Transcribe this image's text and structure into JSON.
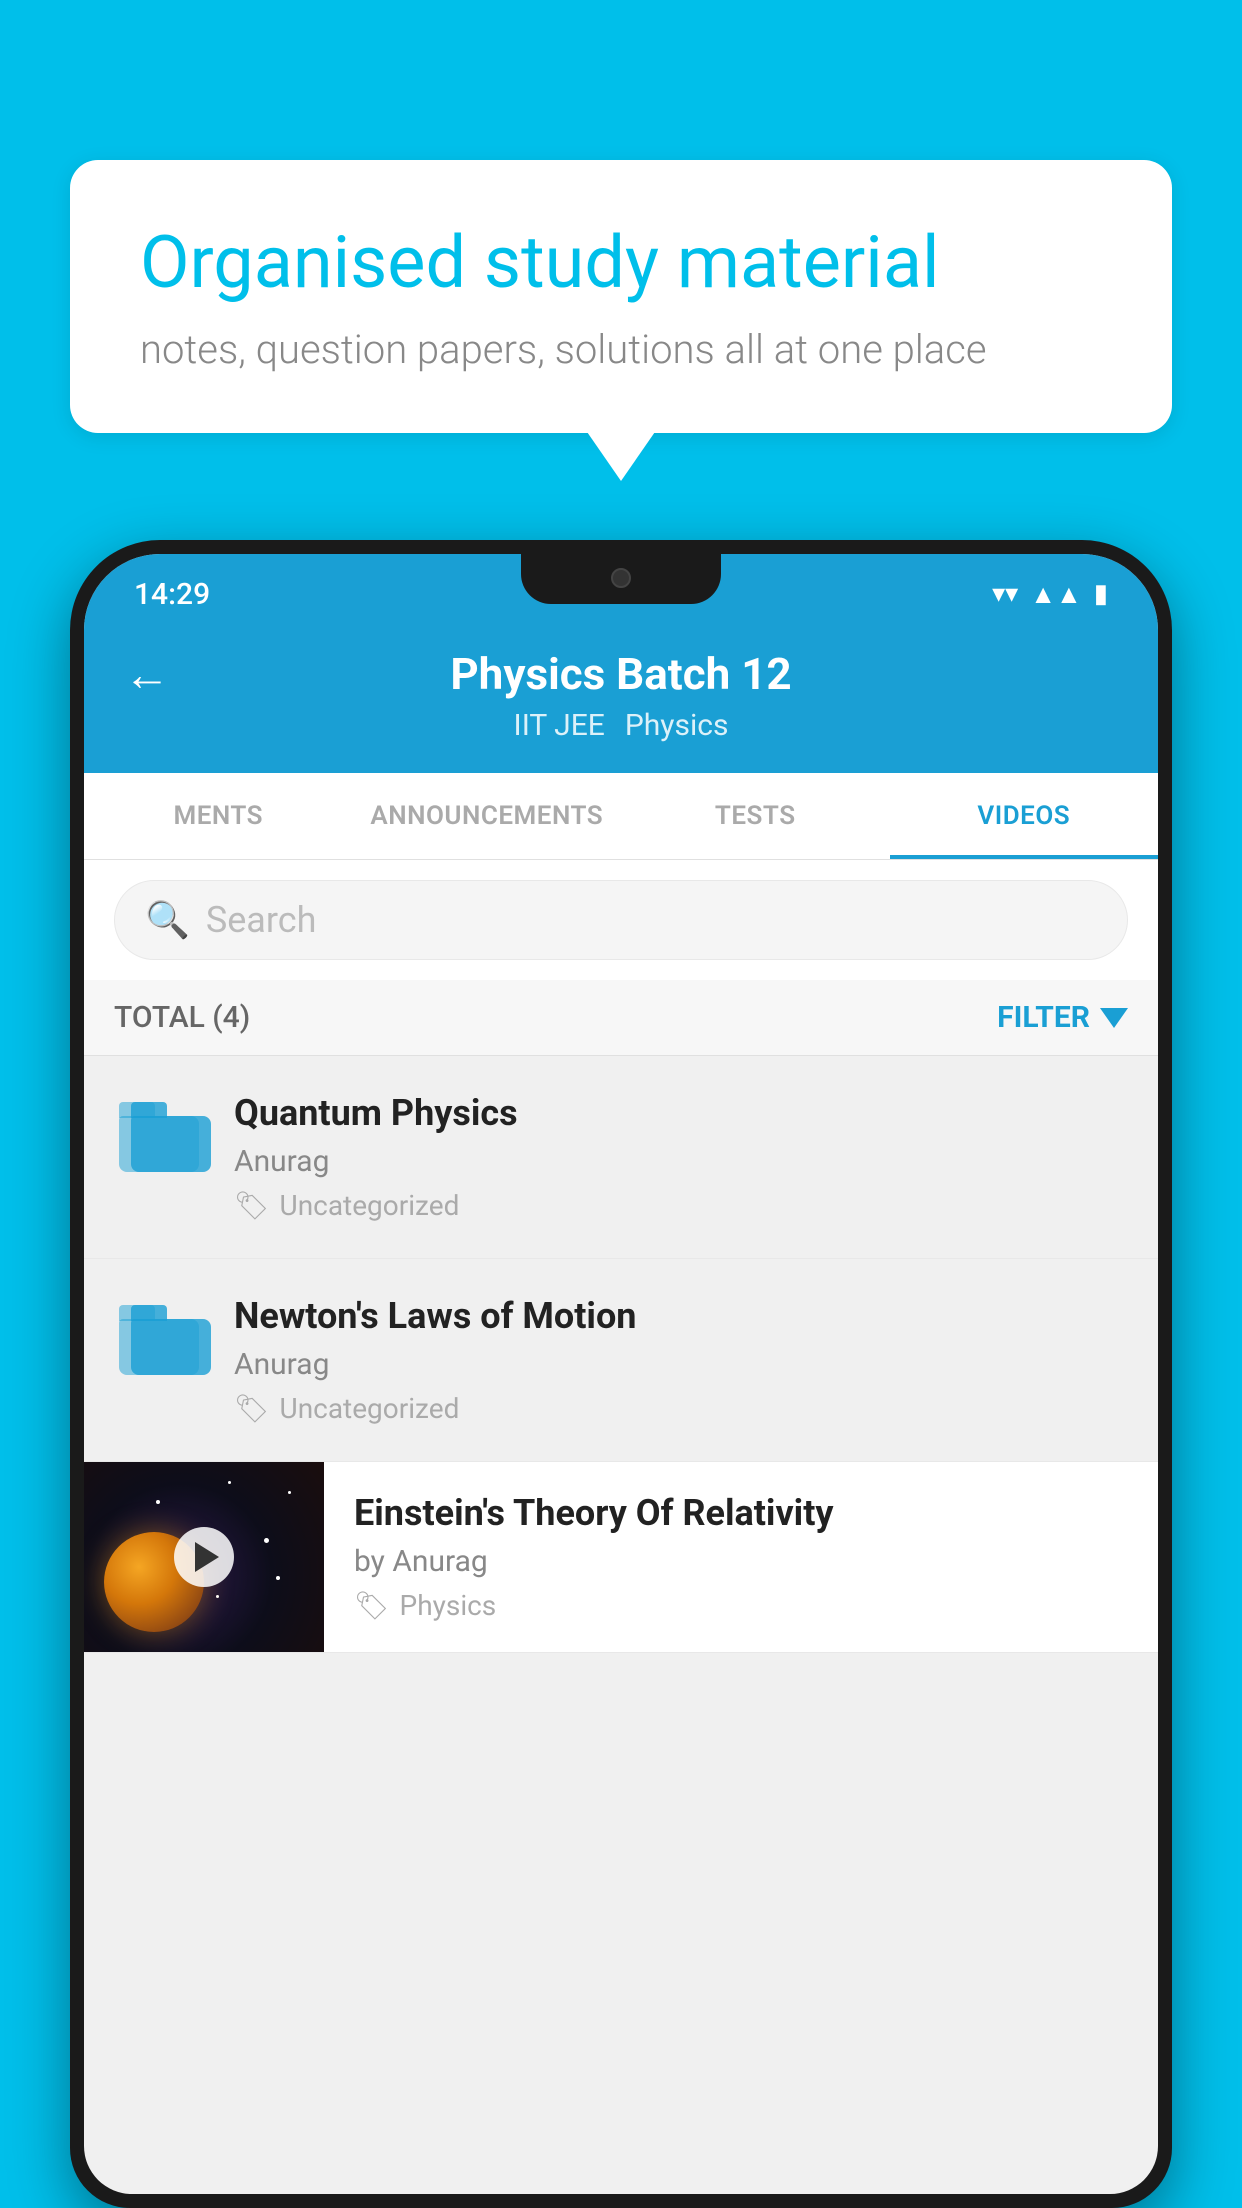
{
  "background": {
    "color": "#00BFEA"
  },
  "speech_bubble": {
    "title": "Organised study material",
    "subtitle": "notes, question papers, solutions all at one place"
  },
  "status_bar": {
    "time": "14:29"
  },
  "header": {
    "title": "Physics Batch 12",
    "subtitle_tag1": "IIT JEE",
    "subtitle_tag2": "Physics",
    "back_label": "←"
  },
  "tabs": [
    {
      "label": "MENTS",
      "active": false
    },
    {
      "label": "ANNOUNCEMENTS",
      "active": false
    },
    {
      "label": "TESTS",
      "active": false
    },
    {
      "label": "VIDEOS",
      "active": true
    }
  ],
  "search": {
    "placeholder": "Search"
  },
  "filter": {
    "total_label": "TOTAL (4)",
    "filter_label": "FILTER"
  },
  "list_items": [
    {
      "title": "Quantum Physics",
      "author": "Anurag",
      "tag": "Uncategorized",
      "type": "folder"
    },
    {
      "title": "Newton's Laws of Motion",
      "author": "Anurag",
      "tag": "Uncategorized",
      "type": "folder"
    }
  ],
  "video_item": {
    "title": "Einstein's Theory Of Relativity",
    "author": "by Anurag",
    "tag": "Physics",
    "type": "video"
  }
}
